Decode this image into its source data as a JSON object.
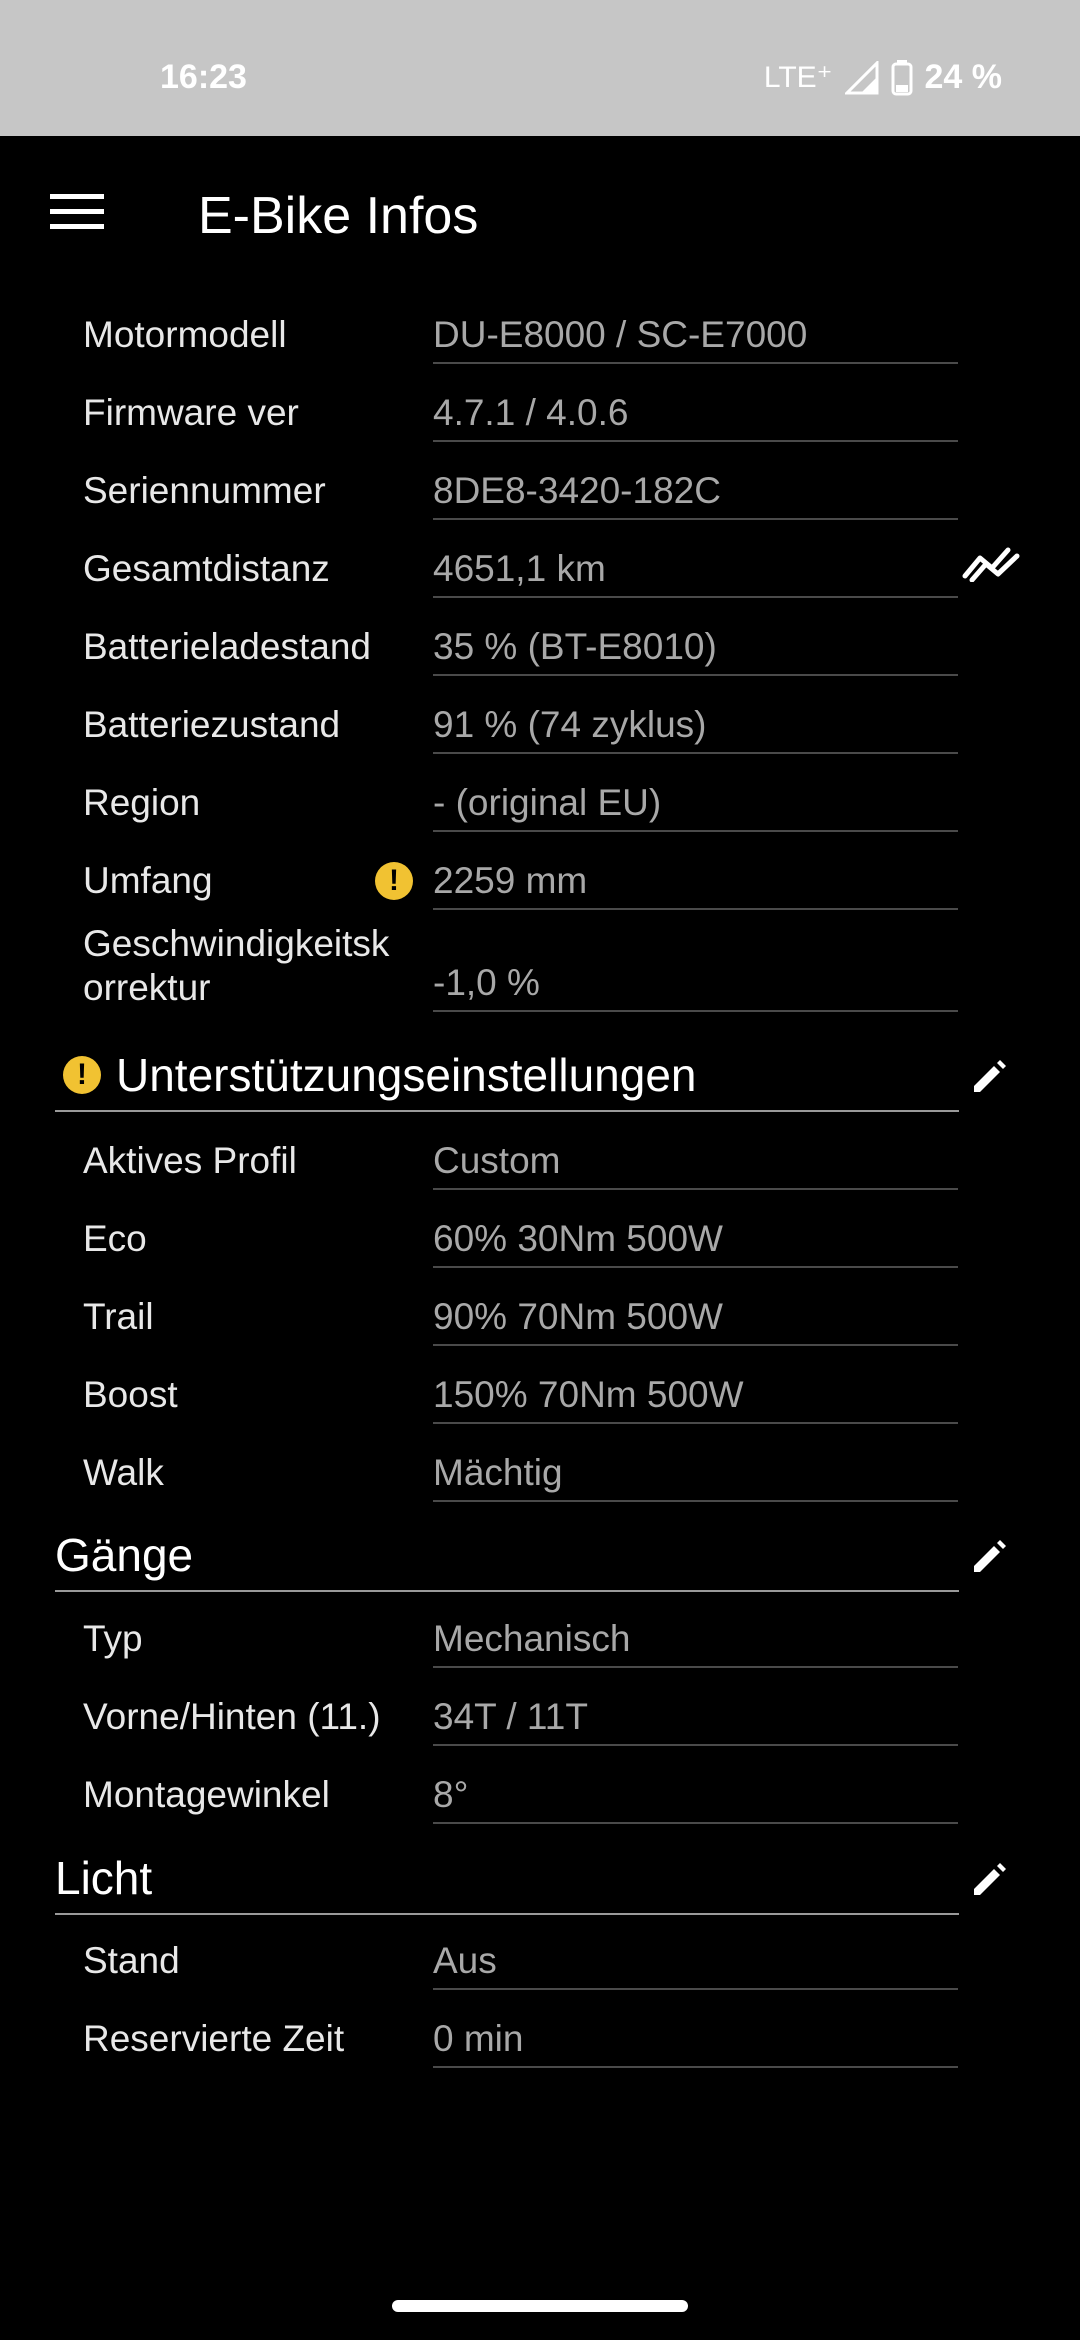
{
  "status_bar": {
    "time": "16:23",
    "network": "LTE⁺",
    "battery": "24 %"
  },
  "app_bar": {
    "title": "E-Bike Infos",
    "menu_icon": "hamburger-menu-icon"
  },
  "info": {
    "rows": [
      {
        "label": "Motormodell",
        "value": "DU-E8000 / SC-E7000"
      },
      {
        "label": "Firmware ver",
        "value": "4.7.1 / 4.0.6"
      },
      {
        "label": "Seriennummer",
        "value": "8DE8-3420-182C"
      },
      {
        "label": "Gesamtdistanz",
        "value": "4651,1 km"
      },
      {
        "label": "Batterieladestand",
        "value": "35 % (BT-E8010)"
      },
      {
        "label": "Batteriezustand",
        "value": "91 % (74 zyklus)"
      },
      {
        "label": "Region",
        "value": "- (original EU)"
      },
      {
        "label": "Umfang",
        "value": "2259 mm"
      },
      {
        "label": "Geschwindigkeitsk\norrektur",
        "value": "-1,0 %"
      }
    ]
  },
  "support": {
    "title": "Unterstützungseinstellungen",
    "rows": [
      {
        "label": "Aktives Profil",
        "value": "Custom"
      },
      {
        "label": "Eco",
        "value": "60% 30Nm 500W"
      },
      {
        "label": "Trail",
        "value": "90% 70Nm 500W"
      },
      {
        "label": "Boost",
        "value": "150% 70Nm 500W"
      },
      {
        "label": "Walk",
        "value": "Mächtig"
      }
    ]
  },
  "gears": {
    "title": "Gänge",
    "rows": [
      {
        "label": "Typ",
        "value": "Mechanisch"
      },
      {
        "label": "Vorne/Hinten (11.)",
        "value": "34T / 11T"
      },
      {
        "label": "Montagewinkel",
        "value": "8°"
      }
    ]
  },
  "light": {
    "title": "Licht",
    "rows": [
      {
        "label": "Stand",
        "value": "Aus"
      },
      {
        "label": "Reservierte Zeit",
        "value": "0 min"
      }
    ]
  },
  "colors": {
    "background": "#000000",
    "status_bar": "#c6c6c6",
    "warning": "#f1c232",
    "label": "#e8e8e8",
    "value": "#a8a8a8"
  }
}
